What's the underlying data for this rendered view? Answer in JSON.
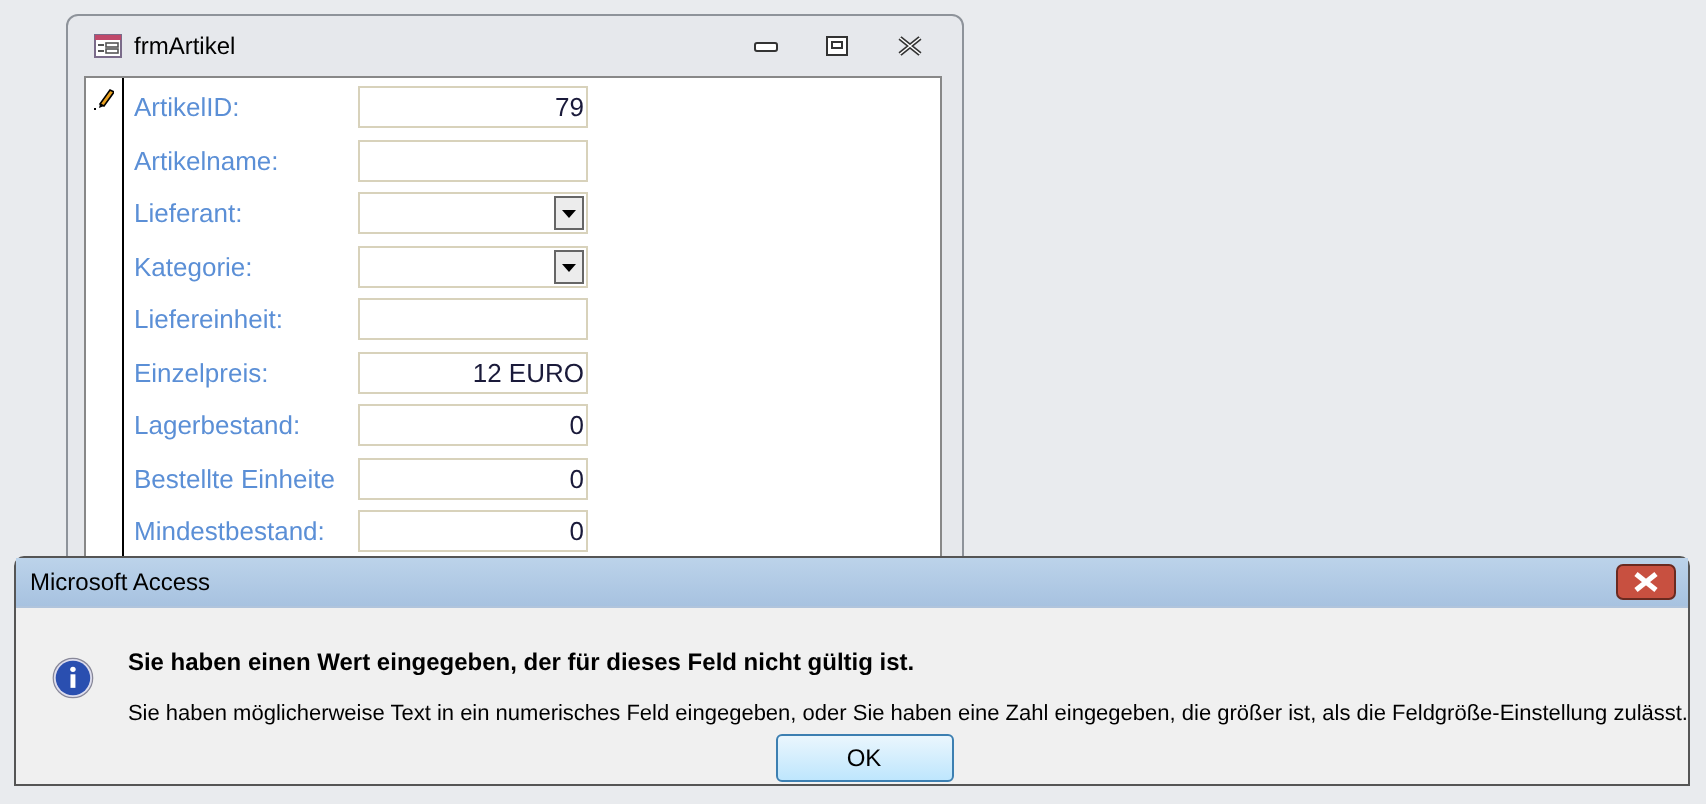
{
  "form_window": {
    "title": "frmArtikel",
    "record_selector": {
      "editing": true
    },
    "fields": [
      {
        "label": "ArtikelID:",
        "kind": "text",
        "value": "79"
      },
      {
        "label": "Artikelname:",
        "kind": "text"
      },
      {
        "label": "Lieferant:",
        "kind": "combo"
      },
      {
        "label": "Kategorie:",
        "kind": "combo"
      },
      {
        "label": "Liefereinheit:",
        "kind": "text"
      },
      {
        "label": "Einzelpreis:",
        "kind": "text",
        "value": "12 EURO"
      },
      {
        "label": "Lagerbestand:",
        "kind": "text",
        "value": "0"
      },
      {
        "label": "Bestellte Einheite",
        "kind": "text",
        "value": "0"
      },
      {
        "label": "Mindestbestand:",
        "kind": "text",
        "value": "0"
      }
    ]
  },
  "dialog": {
    "title": "Microsoft Access",
    "heading": "Sie haben einen Wert eingegeben, der für dieses Feld nicht gültig ist.",
    "message": "Sie haben möglicherweise Text in ein numerisches Feld eingegeben, oder Sie haben eine Zahl eingegeben, die größer ist, als die Feldgröße-Einstellung zulässt.",
    "buttons": [
      "OK"
    ]
  }
}
